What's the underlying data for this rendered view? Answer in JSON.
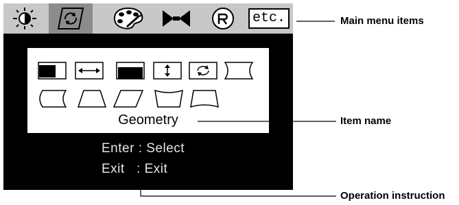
{
  "menu_tabs": [
    {
      "name": "brightness-contrast-icon"
    },
    {
      "name": "geometry-icon",
      "selected": true
    },
    {
      "name": "color-palette-icon"
    },
    {
      "name": "input-position-icon"
    },
    {
      "name": "language-icon"
    },
    {
      "name": "etc-icon",
      "label": "etc."
    }
  ],
  "panel": {
    "item_name": "Geometry",
    "icons": [
      "h-position-icon",
      "h-size-icon",
      "v-position-icon",
      "v-size-icon",
      "rotation-icon",
      "pincushion-icon",
      "pin-balance-icon",
      "trapezoid-icon",
      "parallelogram-icon",
      "top-corner-icon",
      "bottom-corner-icon"
    ]
  },
  "instructions": {
    "enter": "Enter : Select",
    "exit": "Exit   : Exit"
  },
  "callouts": {
    "main_menu": "Main menu items",
    "item_name": "Item name",
    "operation": "Operation instruction"
  },
  "colors": {
    "osd_bg": "#000000",
    "menubar_bg": "#c8c8c8",
    "selected_tab": "#8c8c8c"
  }
}
